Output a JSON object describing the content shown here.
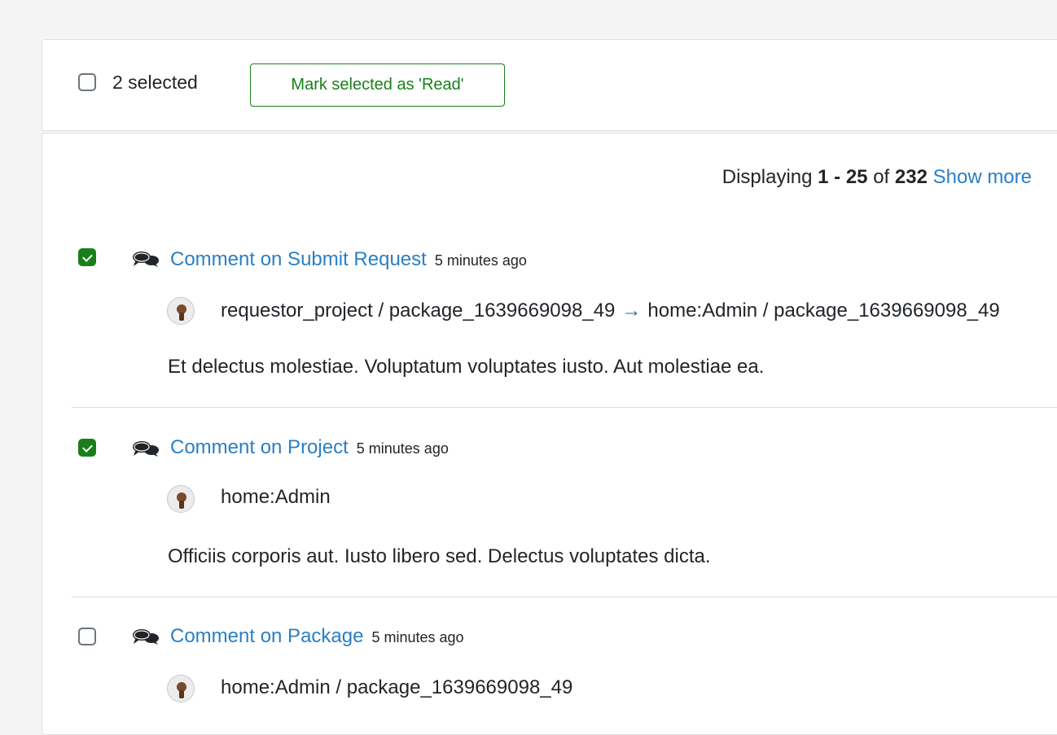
{
  "toolbar": {
    "selected_count": "2 selected",
    "mark_read_label": "Mark selected as 'Read'",
    "select_all_checked": false
  },
  "pagination": {
    "prefix": "Displaying",
    "range": "1 - 25",
    "of": "of",
    "total": "232",
    "show_more": "Show more"
  },
  "notifications": [
    {
      "checked": true,
      "title": "Comment on Submit Request",
      "time": "5 minutes ago",
      "source": "requestor_project / package_1639669098_49",
      "arrow": "→",
      "destination": "home:Admin / package_1639669098_49",
      "body": "Et delectus molestiae. Voluptatum voluptates iusto. Aut molestiae ea."
    },
    {
      "checked": true,
      "title": "Comment on Project",
      "time": "5 minutes ago",
      "source": "home:Admin",
      "body": "Officiis corporis aut. Iusto libero sed. Delectus voluptates dicta."
    },
    {
      "checked": false,
      "title": "Comment on Package",
      "time": "5 minutes ago",
      "source": "home:Admin / package_1639669098_49"
    }
  ],
  "colors": {
    "accent_green": "#1a7f1a",
    "link_blue": "#2a7fc3",
    "arrow_teal": "#1a6f8a"
  },
  "icons": {
    "type_icon": "comments-icon",
    "avatar": "user-avatar"
  }
}
